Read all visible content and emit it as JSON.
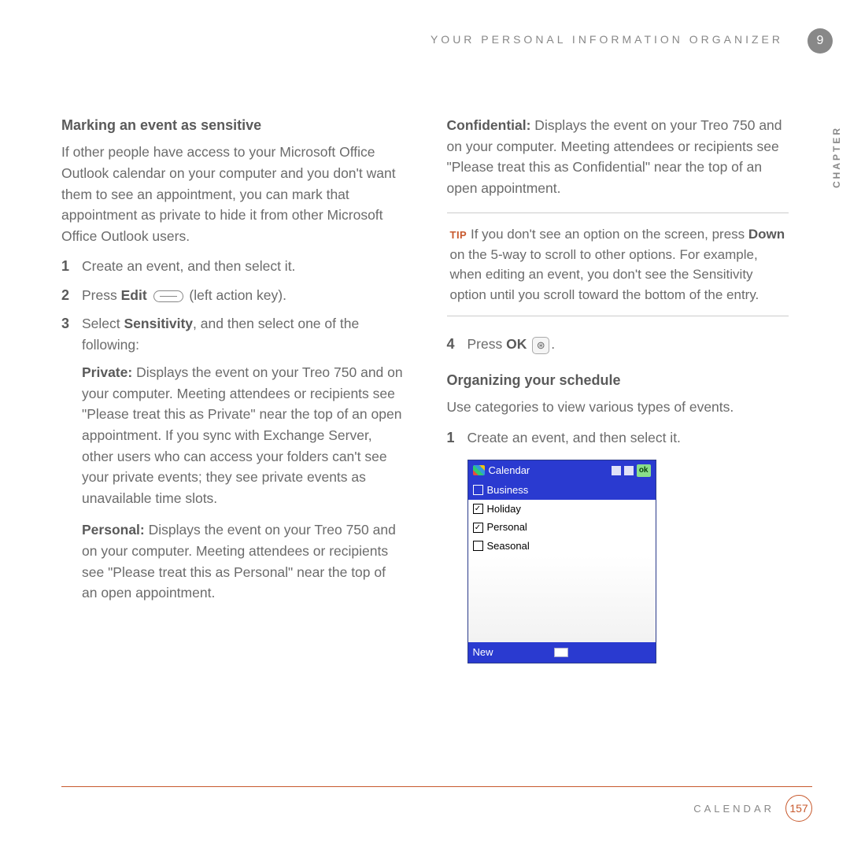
{
  "header": {
    "running_head": "YOUR PERSONAL INFORMATION ORGANIZER",
    "chapter_number": "9",
    "chapter_side_label": "CHAPTER"
  },
  "left_column": {
    "section_title": "Marking an event as sensitive",
    "intro": "If other people have access to your Microsoft Office Outlook calendar on your computer and you don't want them to see an appointment, you can mark that appointment as private to hide it from other Microsoft Office Outlook users.",
    "steps": [
      {
        "num": "1",
        "text_a": "Create an event, and then select it."
      },
      {
        "num": "2",
        "text_a": "Press ",
        "bold_a": "Edit",
        "text_b": " (left action key)."
      },
      {
        "num": "3",
        "text_a": "Select ",
        "bold_a": "Sensitivity",
        "text_b": ", and then select one of the following:"
      }
    ],
    "private_label": "Private:",
    "private_text": " Displays the event on your Treo 750 and on your computer. Meeting attendees or recipients see \"Please treat this as Private\" near the top of an open appointment. If you sync with Exchange Server, other users who can access your folders can't see your private events; they see private events as unavailable time slots.",
    "personal_label": "Personal:",
    "personal_text": " Displays the event on your Treo 750 and on your computer. Meeting attendees or recipients see \"Please treat this as Personal\" near the top of an open appointment."
  },
  "right_column": {
    "confidential_label": "Confidential:",
    "confidential_text": " Displays the event on your Treo 750 and on your computer. Meeting attendees or recipients see \"Please treat this as Confidential\" near the top of an open appointment.",
    "tip_label": "TIP",
    "tip_text_a": "If you don't see an option on the screen, press ",
    "tip_bold": "Down",
    "tip_text_b": " on the 5-way to scroll to other options. For example, when editing an event, you don't see the Sensitivity option until you scroll toward the bottom of the entry.",
    "step4_num": "4",
    "step4_text_a": "Press ",
    "step4_bold": "OK",
    "step4_text_b": ".",
    "organizing_title": "Organizing your schedule",
    "organizing_intro": "Use categories to view various types of events.",
    "org_step1_num": "1",
    "org_step1_text": "Create an event, and then select it."
  },
  "screenshot": {
    "title": "Calendar",
    "ok_label": "ok",
    "categories": [
      {
        "label": "Business",
        "checked": false,
        "selected": true
      },
      {
        "label": "Holiday",
        "checked": true,
        "selected": false
      },
      {
        "label": "Personal",
        "checked": true,
        "selected": false
      },
      {
        "label": "Seasonal",
        "checked": false,
        "selected": false
      }
    ],
    "footer_new": "New"
  },
  "footer": {
    "section_label": "CALENDAR",
    "page_number": "157"
  }
}
